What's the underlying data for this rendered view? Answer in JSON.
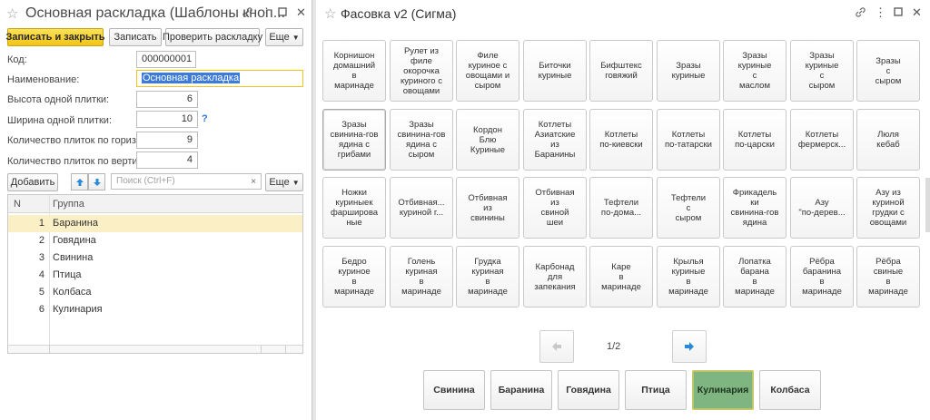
{
  "left_window": {
    "title": "Основная раскладка (Шаблоны кноп...",
    "toolbar": {
      "save_close": "Записать и закрыть",
      "save": "Записать",
      "check": "Проверить раскладку",
      "more": "Еще"
    },
    "form": {
      "code_label": "Код:",
      "code_value": "000000001",
      "name_label": "Наименование:",
      "name_value": "Основная раскладка",
      "tile_height_label": "Высота одной плитки:",
      "tile_height_value": "6",
      "tile_width_label": "Ширина одной плитки:",
      "tile_width_value": "10",
      "help_mark": "?",
      "horizontal_label": "Количество плиток по горизонтали:",
      "horizontal_value": "9",
      "vertical_label": "Количество плиток по вертикали:",
      "vertical_value": "4"
    },
    "table_toolbar": {
      "add": "Добавить",
      "search_placeholder": "Поиск (Ctrl+F)",
      "clear": "×",
      "more": "Еще"
    },
    "table": {
      "col_n": "N",
      "col_group": "Группа",
      "rows": [
        {
          "n": "1",
          "group": "Баранина"
        },
        {
          "n": "2",
          "group": "Говядина"
        },
        {
          "n": "3",
          "group": "Свинина"
        },
        {
          "n": "4",
          "group": "Птица"
        },
        {
          "n": "5",
          "group": "Колбаса"
        },
        {
          "n": "6",
          "group": "Кулинария"
        }
      ],
      "selected_row": 0
    }
  },
  "right_window": {
    "title": "Фасовка v2 (Сигма)",
    "tiles": [
      "Корнишон\nдомашний\nв\nмаринаде",
      "Рулет из\nфиле\nокорочка\nкуриного с\nовощами",
      "Филе\nкуриное с\nовощами и\nсыром",
      "Биточки\nкуриные",
      "Бифштекс\nговяжий",
      "Зразы\nкуриные",
      "Зразы\nкуриные\nс\nмаслом",
      "Зразы\nкуриные\nс\nсыром",
      "Зразы\nс\nсыром",
      "Зразы\nсвинина-гов\nядина с\nгрибами",
      "Зразы\nсвинина-гов\nядина с\nсыром",
      "Кордон\nБлю\nКуриные",
      "Котлеты\nАзиатские\nиз\nБаранины",
      "Котлеты\nпо-киевски",
      "Котлеты\nпо-татарски",
      "Котлеты\nпо-царски",
      "Котлеты\nфермерск...",
      "Люля\nкебаб",
      "Ножки\nкуриныек\nфарширова\nные",
      "Отбивная...\nкуриной г...",
      "Отбивная\nиз\nсвинины",
      "Отбивная\nиз\nсвиной\nшеи",
      "Тефтели\nпо-дома...",
      "Тефтели\nс\nсыром",
      "Фрикадель\nки\nсвинина-гов\nядина",
      "Азу\n\"по-дерев...",
      "Азу из\nкуриной\nгрудки с\nовощами",
      "Бедро\nкуриное\nв\nмаринаде",
      "Голень\nкуриная\nв\nмаринаде",
      "Грудка\nкуриная\nв\nмаринаде",
      "Карбонад\nдля\nзапекания",
      "Каре\nв\nмаринаде",
      "Крылья\nкуриные\nв\nмаринаде",
      "Лопатка\nбарана\nв\nмаринаде",
      "Рёбра\nбаранина\nв\nмаринаде",
      "Рёбра\nсвиные\nв\nмаринаде"
    ],
    "page_indicator": "1/2",
    "groups": [
      "Свинина",
      "Баранина",
      "Говядина",
      "Птица",
      "Кулинария",
      "Колбаса"
    ],
    "active_group": "Кулинария"
  },
  "colors": {
    "primary_button": "#f5cc25",
    "selection_blue": "#3d7bd6",
    "row_highlight": "#fbefc6",
    "active_group": "#7eb581",
    "nav_arrow": "#2a8ad8"
  }
}
